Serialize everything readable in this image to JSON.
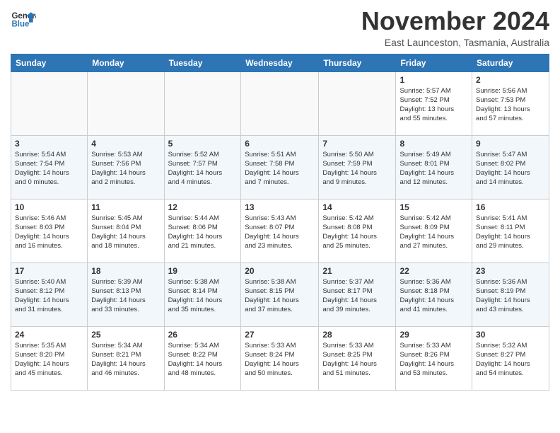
{
  "logo": {
    "line1": "General",
    "line2": "Blue"
  },
  "title": "November 2024",
  "location": "East Launceston, Tasmania, Australia",
  "weekdays": [
    "Sunday",
    "Monday",
    "Tuesday",
    "Wednesday",
    "Thursday",
    "Friday",
    "Saturday"
  ],
  "weeks": [
    [
      {
        "day": "",
        "info": ""
      },
      {
        "day": "",
        "info": ""
      },
      {
        "day": "",
        "info": ""
      },
      {
        "day": "",
        "info": ""
      },
      {
        "day": "",
        "info": ""
      },
      {
        "day": "1",
        "info": "Sunrise: 5:57 AM\nSunset: 7:52 PM\nDaylight: 13 hours\nand 55 minutes."
      },
      {
        "day": "2",
        "info": "Sunrise: 5:56 AM\nSunset: 7:53 PM\nDaylight: 13 hours\nand 57 minutes."
      }
    ],
    [
      {
        "day": "3",
        "info": "Sunrise: 5:54 AM\nSunset: 7:54 PM\nDaylight: 14 hours\nand 0 minutes."
      },
      {
        "day": "4",
        "info": "Sunrise: 5:53 AM\nSunset: 7:56 PM\nDaylight: 14 hours\nand 2 minutes."
      },
      {
        "day": "5",
        "info": "Sunrise: 5:52 AM\nSunset: 7:57 PM\nDaylight: 14 hours\nand 4 minutes."
      },
      {
        "day": "6",
        "info": "Sunrise: 5:51 AM\nSunset: 7:58 PM\nDaylight: 14 hours\nand 7 minutes."
      },
      {
        "day": "7",
        "info": "Sunrise: 5:50 AM\nSunset: 7:59 PM\nDaylight: 14 hours\nand 9 minutes."
      },
      {
        "day": "8",
        "info": "Sunrise: 5:49 AM\nSunset: 8:01 PM\nDaylight: 14 hours\nand 12 minutes."
      },
      {
        "day": "9",
        "info": "Sunrise: 5:47 AM\nSunset: 8:02 PM\nDaylight: 14 hours\nand 14 minutes."
      }
    ],
    [
      {
        "day": "10",
        "info": "Sunrise: 5:46 AM\nSunset: 8:03 PM\nDaylight: 14 hours\nand 16 minutes."
      },
      {
        "day": "11",
        "info": "Sunrise: 5:45 AM\nSunset: 8:04 PM\nDaylight: 14 hours\nand 18 minutes."
      },
      {
        "day": "12",
        "info": "Sunrise: 5:44 AM\nSunset: 8:06 PM\nDaylight: 14 hours\nand 21 minutes."
      },
      {
        "day": "13",
        "info": "Sunrise: 5:43 AM\nSunset: 8:07 PM\nDaylight: 14 hours\nand 23 minutes."
      },
      {
        "day": "14",
        "info": "Sunrise: 5:42 AM\nSunset: 8:08 PM\nDaylight: 14 hours\nand 25 minutes."
      },
      {
        "day": "15",
        "info": "Sunrise: 5:42 AM\nSunset: 8:09 PM\nDaylight: 14 hours\nand 27 minutes."
      },
      {
        "day": "16",
        "info": "Sunrise: 5:41 AM\nSunset: 8:11 PM\nDaylight: 14 hours\nand 29 minutes."
      }
    ],
    [
      {
        "day": "17",
        "info": "Sunrise: 5:40 AM\nSunset: 8:12 PM\nDaylight: 14 hours\nand 31 minutes."
      },
      {
        "day": "18",
        "info": "Sunrise: 5:39 AM\nSunset: 8:13 PM\nDaylight: 14 hours\nand 33 minutes."
      },
      {
        "day": "19",
        "info": "Sunrise: 5:38 AM\nSunset: 8:14 PM\nDaylight: 14 hours\nand 35 minutes."
      },
      {
        "day": "20",
        "info": "Sunrise: 5:38 AM\nSunset: 8:15 PM\nDaylight: 14 hours\nand 37 minutes."
      },
      {
        "day": "21",
        "info": "Sunrise: 5:37 AM\nSunset: 8:17 PM\nDaylight: 14 hours\nand 39 minutes."
      },
      {
        "day": "22",
        "info": "Sunrise: 5:36 AM\nSunset: 8:18 PM\nDaylight: 14 hours\nand 41 minutes."
      },
      {
        "day": "23",
        "info": "Sunrise: 5:36 AM\nSunset: 8:19 PM\nDaylight: 14 hours\nand 43 minutes."
      }
    ],
    [
      {
        "day": "24",
        "info": "Sunrise: 5:35 AM\nSunset: 8:20 PM\nDaylight: 14 hours\nand 45 minutes."
      },
      {
        "day": "25",
        "info": "Sunrise: 5:34 AM\nSunset: 8:21 PM\nDaylight: 14 hours\nand 46 minutes."
      },
      {
        "day": "26",
        "info": "Sunrise: 5:34 AM\nSunset: 8:22 PM\nDaylight: 14 hours\nand 48 minutes."
      },
      {
        "day": "27",
        "info": "Sunrise: 5:33 AM\nSunset: 8:24 PM\nDaylight: 14 hours\nand 50 minutes."
      },
      {
        "day": "28",
        "info": "Sunrise: 5:33 AM\nSunset: 8:25 PM\nDaylight: 14 hours\nand 51 minutes."
      },
      {
        "day": "29",
        "info": "Sunrise: 5:33 AM\nSunset: 8:26 PM\nDaylight: 14 hours\nand 53 minutes."
      },
      {
        "day": "30",
        "info": "Sunrise: 5:32 AM\nSunset: 8:27 PM\nDaylight: 14 hours\nand 54 minutes."
      }
    ]
  ]
}
